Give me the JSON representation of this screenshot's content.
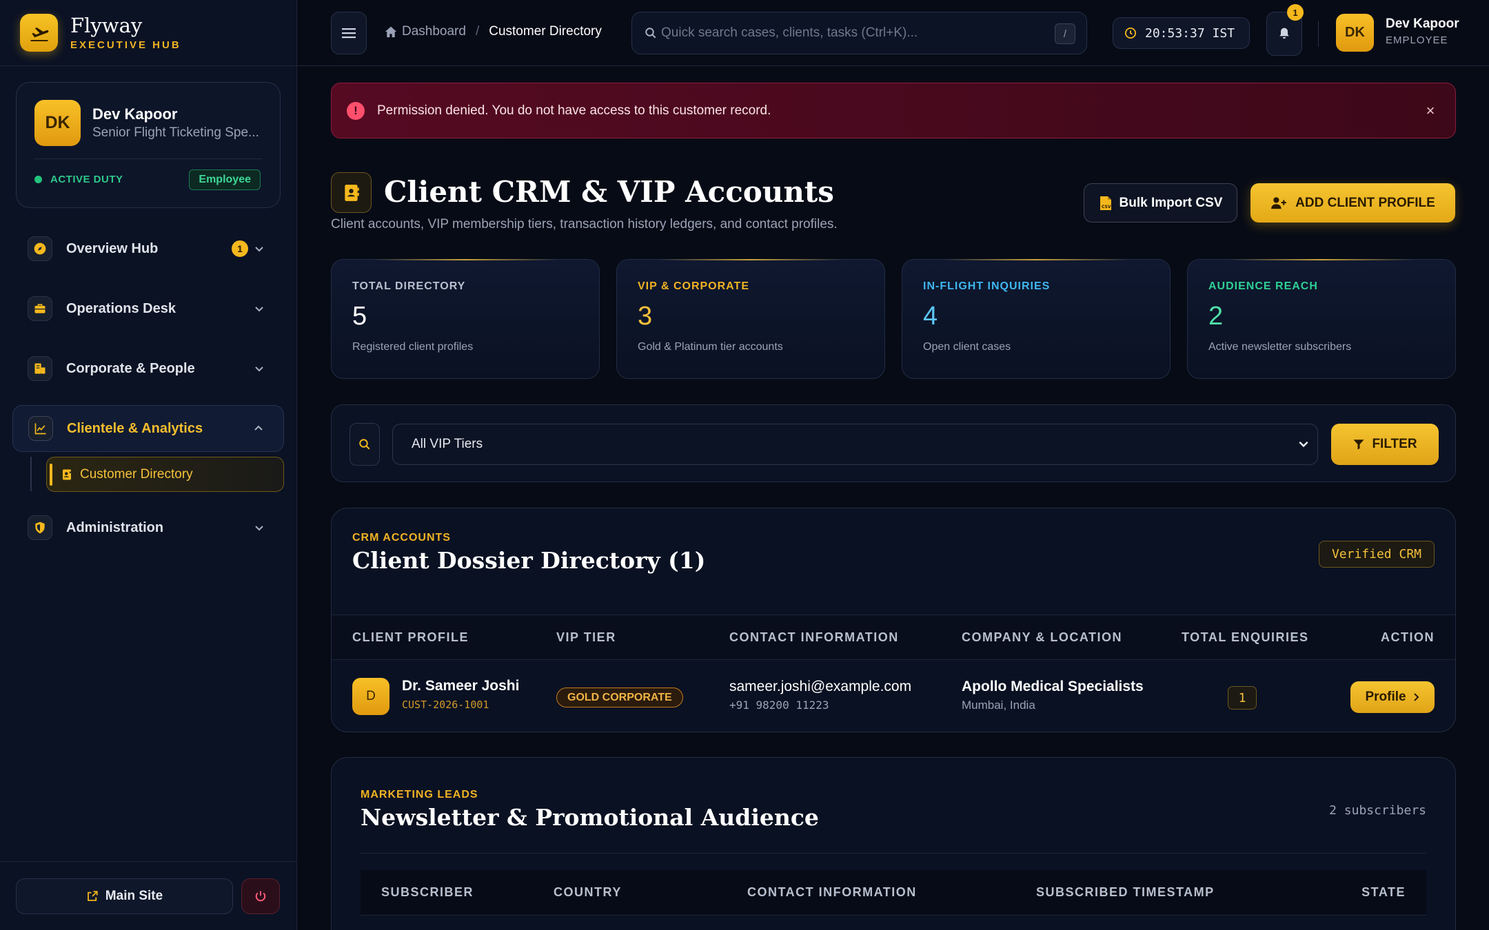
{
  "brand": {
    "name": "Flyway",
    "sub": "EXECUTIVE HUB"
  },
  "profile": {
    "initials": "DK",
    "name": "Dev Kapoor",
    "role": "Senior Flight Ticketing Spe...",
    "status": "ACTIVE DUTY",
    "badge": "Employee"
  },
  "nav": {
    "items": [
      {
        "label": "Overview Hub",
        "badge": "1",
        "icon": "compass-icon"
      },
      {
        "label": "Operations Desk",
        "icon": "briefcase-icon"
      },
      {
        "label": "Corporate & People",
        "icon": "building-icon"
      },
      {
        "label": "Clientele & Analytics",
        "icon": "chart-line-icon",
        "expanded": true
      },
      {
        "label": "Administration",
        "icon": "shield-icon"
      }
    ],
    "sub_item": {
      "label": "Customer Directory",
      "icon": "contact-card-icon"
    }
  },
  "sidebar_footer": {
    "main_site": "Main Site"
  },
  "header": {
    "breadcrumb": {
      "home": "Dashboard",
      "separator": "/",
      "current": "Customer Directory"
    },
    "search_placeholder": "Quick search cases, clients, tasks (Ctrl+K)...",
    "search_shortcut": "/",
    "clock": "20:53:37 IST",
    "notifications": "1",
    "user": {
      "initials": "DK",
      "name": "Dev Kapoor",
      "role": "EMPLOYEE"
    }
  },
  "alert": {
    "text": "Permission denied. You do not have access to this customer record.",
    "close": "×"
  },
  "page": {
    "title": "Client CRM & VIP Accounts",
    "subtitle": "Client accounts, VIP membership tiers, transaction history ledgers, and contact profiles.",
    "import_button": "Bulk Import CSV",
    "add_button": "ADD CLIENT PROFILE"
  },
  "stats": [
    {
      "label": "TOTAL DIRECTORY",
      "value": "5",
      "desc": "Registered client profiles",
      "color": "#b8c0ce",
      "value_color": "#ffffff"
    },
    {
      "label": "VIP & CORPORATE",
      "value": "3",
      "desc": "Gold & Platinum tier accounts",
      "color": "#f0b323",
      "value_color": "#f5c13a"
    },
    {
      "label": "IN-FLIGHT INQUIRIES",
      "value": "4",
      "desc": "Open client cases",
      "color": "#3fb7f0",
      "value_color": "#5cc5f5"
    },
    {
      "label": "AUDIENCE REACH",
      "value": "2",
      "desc": "Active newsletter subscribers",
      "color": "#2fd094",
      "value_color": "#4fe0a8"
    }
  ],
  "filter": {
    "select_value": "All VIP Tiers",
    "button": "FILTER"
  },
  "directory": {
    "eyebrow": "CRM ACCOUNTS",
    "title": "Client Dossier Directory (1)",
    "verified": "Verified CRM",
    "columns": [
      "CLIENT PROFILE",
      "VIP TIER",
      "CONTACT INFORMATION",
      "COMPANY & LOCATION",
      "TOTAL ENQUIRIES",
      "ACTION"
    ],
    "rows": [
      {
        "initial": "D",
        "name": "Dr. Sameer Joshi",
        "id": "CUST-2026-1001",
        "tier": "GOLD CORPORATE",
        "email": "sameer.joshi@example.com",
        "phone": "+91 98200 11223",
        "company": "Apollo Medical Specialists",
        "location": "Mumbai, India",
        "enquiries": "1",
        "action": "Profile"
      }
    ]
  },
  "newsletter": {
    "eyebrow": "MARKETING LEADS",
    "title": "Newsletter & Promotional Audience",
    "count": "2 subscribers",
    "columns": [
      "SUBSCRIBER",
      "COUNTRY",
      "CONTACT INFORMATION",
      "SUBSCRIBED TIMESTAMP",
      "STATE"
    ]
  },
  "colors": {
    "accent": "#f5b81d",
    "background": "#070b16",
    "danger": "#ff4f6d",
    "success": "#22c37c"
  }
}
